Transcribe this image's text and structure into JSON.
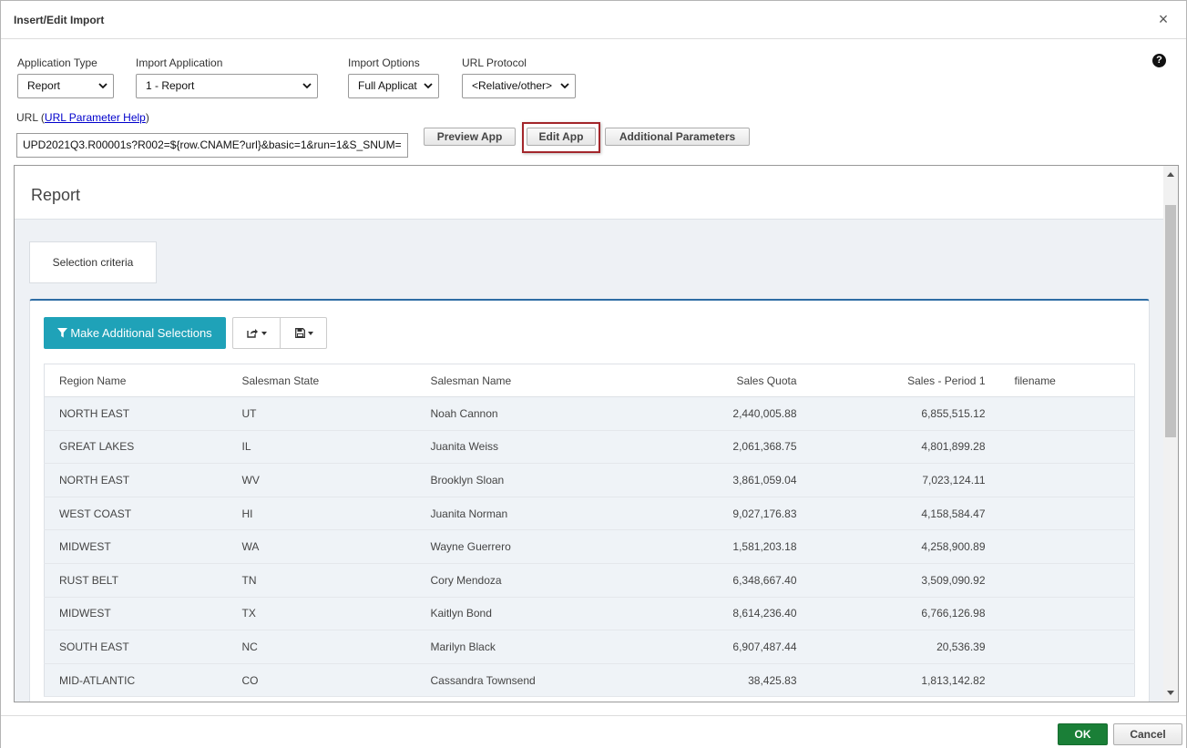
{
  "dialog": {
    "title": "Insert/Edit Import",
    "close_glyph": "×"
  },
  "help": {
    "glyph": "?"
  },
  "fields": {
    "application_type": {
      "label": "Application Type",
      "value": "Report"
    },
    "import_application": {
      "label": "Import Application",
      "value": "1 - Report"
    },
    "import_options": {
      "label": "Import Options",
      "value": "Full Applicat"
    },
    "url_protocol": {
      "label": "URL Protocol",
      "value": "<Relative/other>"
    }
  },
  "url": {
    "label": "URL",
    "help_link": "URL Parameter Help",
    "value": "UPD2021Q3.R00001s?R002=${row.CNAME?url}&basic=1&run=1&S_SNUM="
  },
  "buttons": {
    "preview": "Preview App",
    "edit": "Edit App",
    "additional": "Additional Parameters",
    "ok": "OK",
    "cancel": "Cancel"
  },
  "report": {
    "title": "Report",
    "tab_label": "Selection criteria",
    "make_selections_label": "Make Additional Selections",
    "columns": [
      "Region Name",
      "Salesman State",
      "Salesman Name",
      "Sales Quota",
      "Sales - Period 1",
      "filename"
    ],
    "rows": [
      [
        "NORTH EAST",
        "UT",
        "Noah Cannon",
        "2,440,005.88",
        "6,855,515.12",
        ""
      ],
      [
        "GREAT LAKES",
        "IL",
        "Juanita Weiss",
        "2,061,368.75",
        "4,801,899.28",
        ""
      ],
      [
        "NORTH EAST",
        "WV",
        "Brooklyn Sloan",
        "3,861,059.04",
        "7,023,124.11",
        ""
      ],
      [
        "WEST COAST",
        "HI",
        "Juanita Norman",
        "9,027,176.83",
        "4,158,584.47",
        ""
      ],
      [
        "MIDWEST",
        "WA",
        "Wayne Guerrero",
        "1,581,203.18",
        "4,258,900.89",
        ""
      ],
      [
        "RUST BELT",
        "TN",
        "Cory Mendoza",
        "6,348,667.40",
        "3,509,090.92",
        ""
      ],
      [
        "MIDWEST",
        "TX",
        "Kaitlyn Bond",
        "8,614,236.40",
        "6,766,126.98",
        ""
      ],
      [
        "SOUTH EAST",
        "NC",
        "Marilyn Black",
        "6,907,487.44",
        "20,536.39",
        ""
      ],
      [
        "MID-ATLANTIC",
        "CO",
        "Cassandra Townsend",
        "38,425.83",
        "1,813,142.82",
        ""
      ]
    ]
  },
  "colors": {
    "ok": "#1a7f37",
    "make_selections": "#1fa2b8",
    "highlight": "#a3262b",
    "panel_accent": "#2e6da4"
  }
}
